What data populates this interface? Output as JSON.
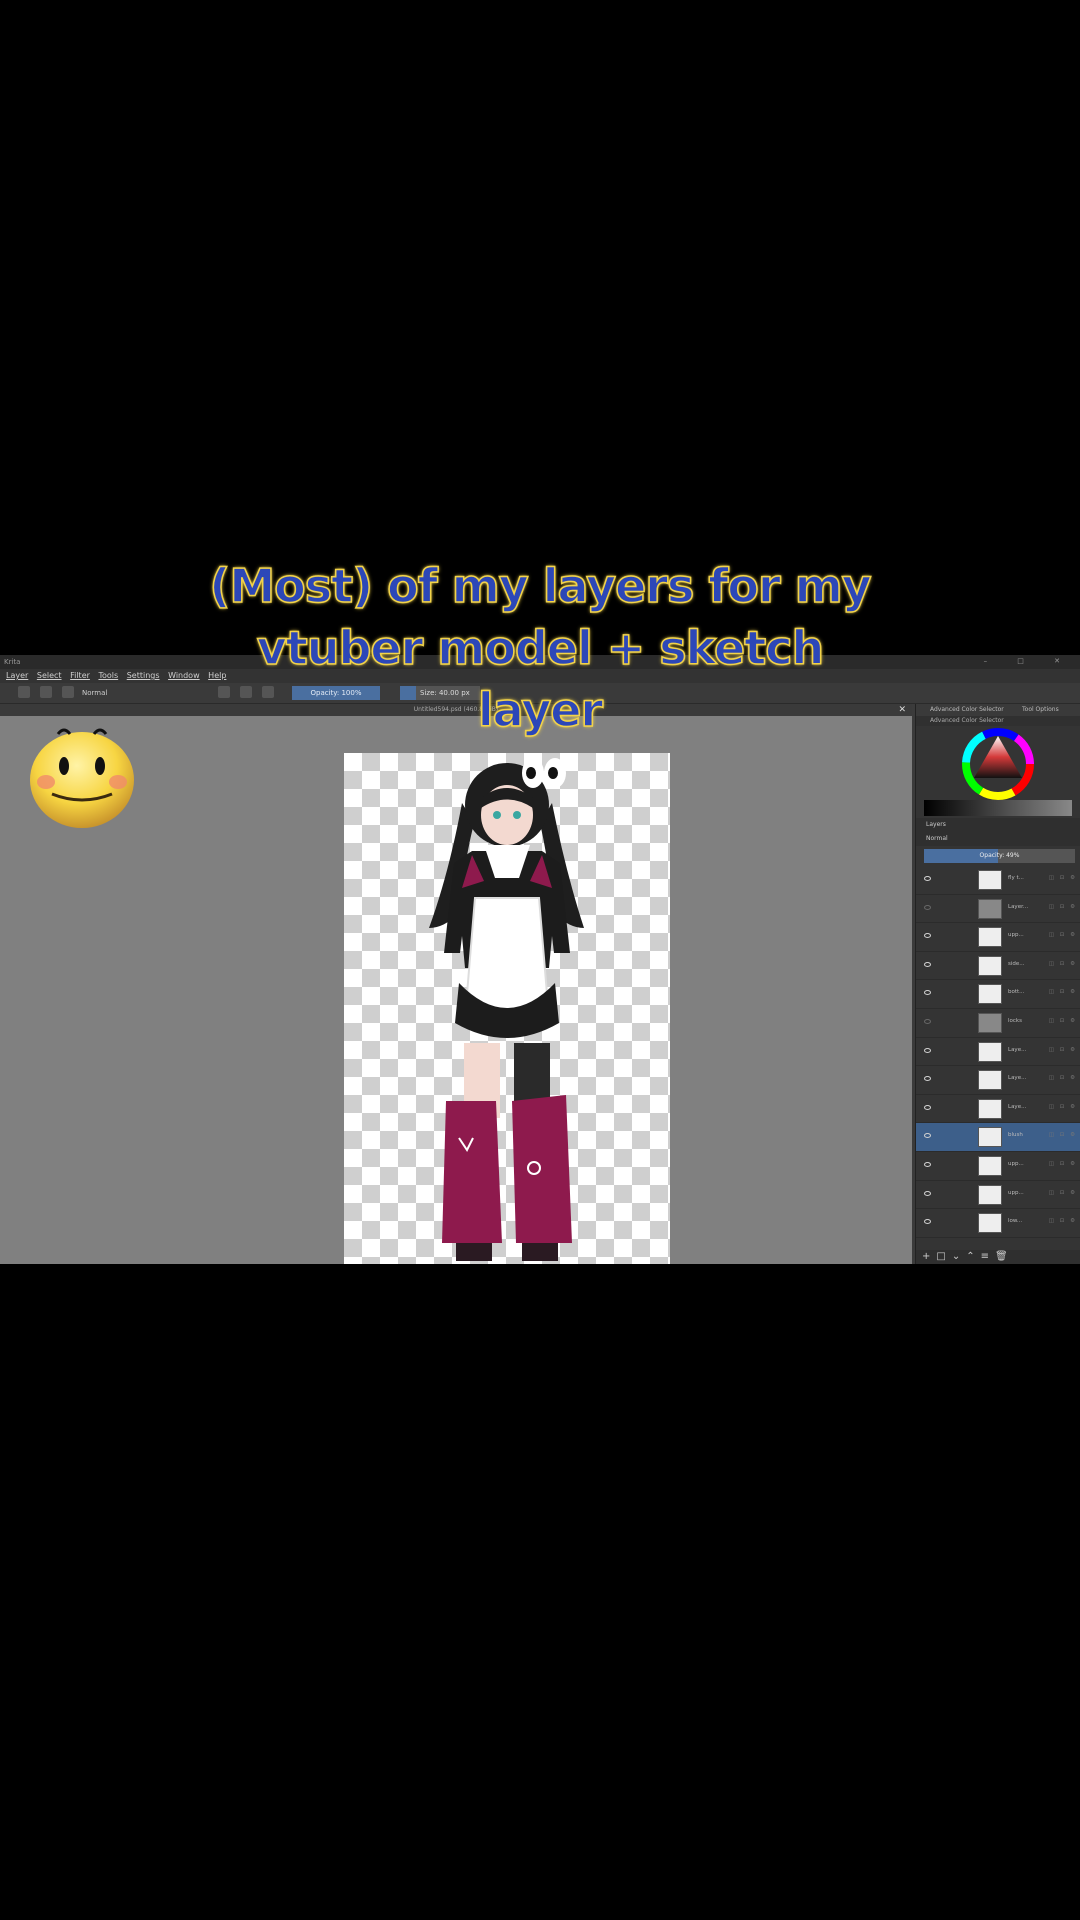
{
  "caption": {
    "line1": "(Most) of my layers for my",
    "line2": "vtuber model + sketch",
    "line3": "layer"
  },
  "app": {
    "title": "Krita",
    "window_controls": "– □ ✕",
    "menu": [
      "Layer",
      "Select",
      "Filter",
      "Tools",
      "Settings",
      "Window",
      "Help"
    ],
    "toolbar": {
      "blend_mode": "Normal",
      "opacity_label": "Opacity: 100%",
      "size_label": "Size: 40.00 px",
      "size_fraction": 0.2
    },
    "document_tab": "Untitled594.psd (460.8 MiB)",
    "dock": {
      "tab1": "Advanced Color Selector",
      "tab2": "Tool Options",
      "color_panel_header": "Advanced Color Selector",
      "layers_header": "Layers",
      "layers_blend": "Normal",
      "layers_opacity": "Opacity: 49%",
      "layers_opacity_fraction": 0.49,
      "layers": [
        {
          "name": "fly t...",
          "visible": true,
          "selected": false
        },
        {
          "name": "Layer...",
          "visible": false,
          "selected": false
        },
        {
          "name": "upp...",
          "visible": true,
          "selected": false
        },
        {
          "name": "side...",
          "visible": true,
          "selected": false
        },
        {
          "name": "bott...",
          "visible": true,
          "selected": false
        },
        {
          "name": "locks",
          "visible": false,
          "selected": false
        },
        {
          "name": "Laye...",
          "visible": true,
          "selected": false
        },
        {
          "name": "Laye...",
          "visible": true,
          "selected": false
        },
        {
          "name": "Laye...",
          "visible": true,
          "selected": false
        },
        {
          "name": "blush",
          "visible": true,
          "selected": true
        },
        {
          "name": "upp...",
          "visible": true,
          "selected": false
        },
        {
          "name": "upp...",
          "visible": true,
          "selected": false
        },
        {
          "name": "low...",
          "visible": true,
          "selected": false
        }
      ]
    }
  },
  "colors": {
    "caption_fill": "#2c47b8",
    "caption_outline": "#f2d34a",
    "selection": "#3d5f8a",
    "accent_blue": "#4a6fa0"
  }
}
